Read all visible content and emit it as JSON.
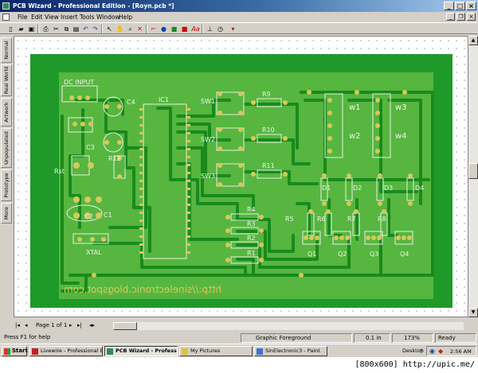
{
  "window": {
    "title": "PCB Wizard - Professional Edition - [Royn.pcb *]"
  },
  "menu": [
    "File",
    "Edit",
    "View",
    "Insert",
    "Tools",
    "Window",
    "Help"
  ],
  "toolbar_icons": [
    "new-icon",
    "open-icon",
    "save-icon",
    "print-icon",
    "cut-icon",
    "copy-icon",
    "paste-icon",
    "delete-icon",
    "undo-icon",
    "redo-icon",
    "arrow-icon",
    "hand-icon",
    "zoom-icon",
    "cross-icon",
    "line-icon",
    "pad-icon",
    "fill-icon",
    "rect-icon",
    "text-icon",
    "measure-icon",
    "clock-icon",
    "component-icon"
  ],
  "left_tabs": [
    "Normal",
    "Real World",
    "Artwork",
    "Unpopulated",
    "Prototype",
    "More"
  ],
  "board": {
    "components": [
      "DC INPUT",
      "C4",
      "IC1",
      "SW1",
      "SW2",
      "SW3",
      "R9",
      "R10",
      "R11",
      "w1",
      "w2",
      "w3",
      "w4",
      "C3",
      "R12",
      "Rst",
      "C2",
      "C1",
      "XTAL",
      "D1",
      "D2",
      "D3",
      "D4",
      "R5",
      "R6",
      "R7",
      "R8",
      "R4",
      "R3",
      "R2",
      "R1",
      "Q1",
      "Q2",
      "Q3",
      "Q4"
    ],
    "watermark": "http://sinelectronic.blogspot.com"
  },
  "pagebar": {
    "page": "Page 1 of 1"
  },
  "status": {
    "help": "Press F1 for help",
    "layer": "Graphic Foreground",
    "grid": "0.1 in",
    "zoom": "173%",
    "state": "Ready"
  },
  "taskbar": {
    "start": "Start",
    "buttons": [
      {
        "label": "Livewire - Professional E..."
      },
      {
        "label": "PCB Wizard - Professi..."
      },
      {
        "label": "My Pictures"
      },
      {
        "label": "SinElectronic3 - Paint"
      }
    ],
    "desktop": "Desktop",
    "clock": "2:56 AM"
  },
  "footer_text": "[800x600] http://upic.me/",
  "colors": {
    "board": "#1f9a2a",
    "board_fill": "#56b640",
    "copper": "#d8c85a",
    "track": "#1a8a1c"
  }
}
